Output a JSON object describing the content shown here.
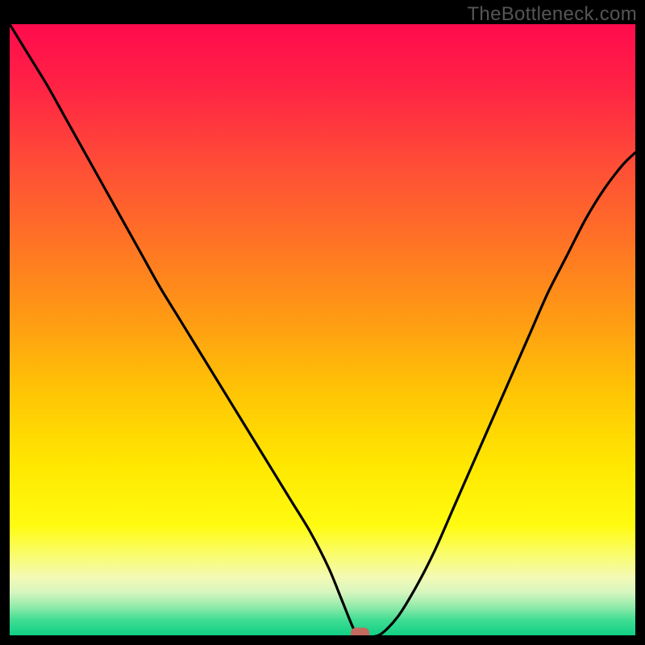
{
  "watermark": "TheBottleneck.com",
  "chart_data": {
    "type": "line",
    "title": "",
    "xlabel": "",
    "ylabel": "",
    "xlim": [
      0,
      100
    ],
    "ylim": [
      0,
      100
    ],
    "grid": false,
    "legend": false,
    "series": [
      {
        "name": "bottleneck-curve",
        "x": [
          0,
          3,
          6,
          9,
          12,
          15,
          18,
          21,
          24,
          27,
          30,
          33,
          36,
          39,
          42,
          45,
          48,
          51,
          53,
          55,
          56,
          59,
          62,
          65,
          68,
          71,
          74,
          77,
          80,
          83,
          86,
          89,
          92,
          95,
          98,
          100
        ],
        "values": [
          100,
          95,
          90,
          84.5,
          79,
          73.5,
          68,
          62.5,
          57,
          52,
          47,
          42,
          37,
          32,
          27,
          22,
          17,
          11,
          6,
          1,
          0,
          0,
          3,
          8,
          14,
          21,
          28,
          35,
          42,
          49,
          56,
          62,
          68,
          73,
          77,
          79
        ]
      }
    ],
    "marker": {
      "x": 56,
      "y": 0
    },
    "background_gradient": {
      "stops": [
        {
          "offset": 0.0,
          "color": "#ff0b4d"
        },
        {
          "offset": 0.1,
          "color": "#ff2245"
        },
        {
          "offset": 0.22,
          "color": "#ff4a38"
        },
        {
          "offset": 0.35,
          "color": "#ff7126"
        },
        {
          "offset": 0.48,
          "color": "#ff9a14"
        },
        {
          "offset": 0.6,
          "color": "#ffc405"
        },
        {
          "offset": 0.72,
          "color": "#ffe700"
        },
        {
          "offset": 0.82,
          "color": "#fffb10"
        },
        {
          "offset": 0.865,
          "color": "#fafc67"
        },
        {
          "offset": 0.905,
          "color": "#f3fab4"
        },
        {
          "offset": 0.93,
          "color": "#d6f6bf"
        },
        {
          "offset": 0.955,
          "color": "#8be9a8"
        },
        {
          "offset": 0.975,
          "color": "#3fdd93"
        },
        {
          "offset": 1.0,
          "color": "#11d085"
        }
      ]
    }
  }
}
